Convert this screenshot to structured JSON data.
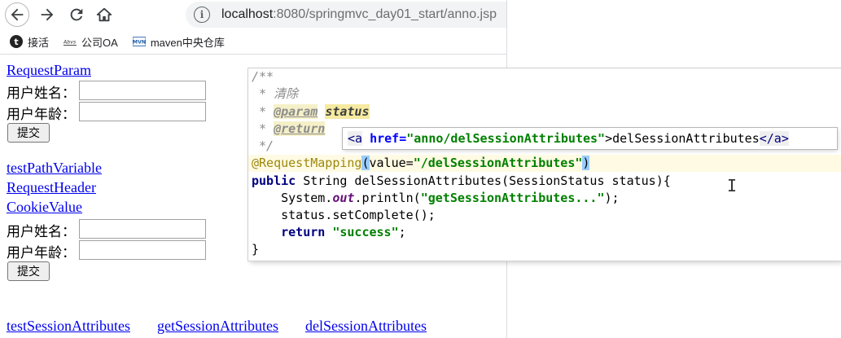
{
  "browser": {
    "url_host": "localhost",
    "url_rest": ":8080/springmvc_day01_start/anno.jsp",
    "bookmarks": [
      {
        "label": "接活",
        "icon": "t-circle-icon"
      },
      {
        "label": "公司OA",
        "icon": "abvs-icon"
      },
      {
        "label": "maven中央仓库",
        "icon": "mvn-icon"
      }
    ]
  },
  "page": {
    "form1": {
      "link": "RequestParam",
      "username_label": "用户姓名：",
      "age_label": "用户年龄：",
      "submit": "提交"
    },
    "links_mid": [
      "testPathVariable",
      "RequestHeader",
      "CookieValue"
    ],
    "form2": {
      "username_label": "用户姓名：",
      "age_label": "用户年龄：",
      "submit": "提交"
    },
    "links_bottom": [
      "testSessionAttributes",
      "getSessionAttributes",
      "delSessionAttributes"
    ]
  },
  "code": {
    "l1": "/**",
    "l2": " * 清除",
    "l3_prefix": " * ",
    "l3_tag": "@param",
    "l3_param": "status",
    "l4_prefix": " * ",
    "l4_tag": "@return",
    "l5": " */",
    "anno": "@RequestMapping",
    "anno_open": "(",
    "anno_value": "value=",
    "anno_str": "\"/delSessionAttributes\"",
    "anno_close": ")",
    "sig_kw": "public",
    "sig_rest": " String delSessionAttributes(SessionStatus status){",
    "p1_a": "    System.",
    "p1_out": "out",
    "p1_b": ".println(",
    "p1_str": "\"getSessionAttributes...\"",
    "p1_c": ");",
    "p2": "    status.setComplete();",
    "p3_kw": "    return",
    "p3_str": " \"success\"",
    "p3_end": ";",
    "close": "}"
  },
  "popup": {
    "tag_open": "<a",
    "attr": " href=",
    "attr_val": "\"anno/delSessionAttributes\"",
    "text": ">delSessionAttributes",
    "tag_close": "</a>"
  }
}
